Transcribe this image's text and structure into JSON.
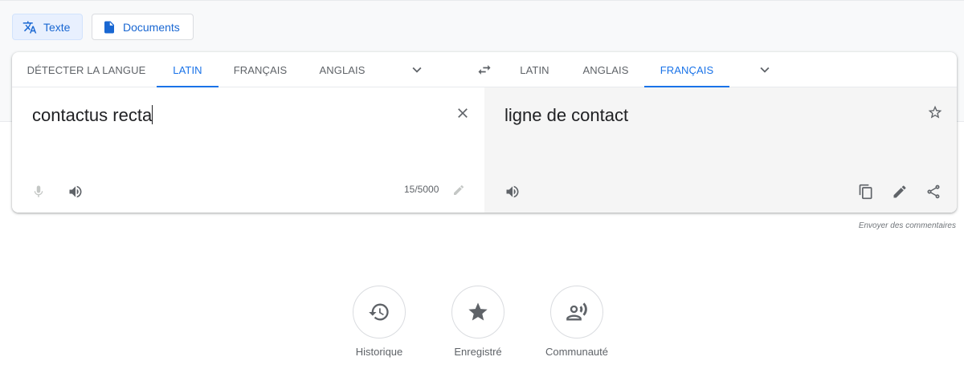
{
  "mode_buttons": {
    "text_label": "Texte",
    "docs_label": "Documents"
  },
  "source_langs": [
    "DÉTECTER LA LANGUE",
    "LATIN",
    "FRANÇAIS",
    "ANGLAIS"
  ],
  "target_langs": [
    "LATIN",
    "ANGLAIS",
    "FRANÇAIS"
  ],
  "selected_source": "LATIN",
  "selected_target": "FRANÇAIS",
  "source": {
    "text": "contactus recta",
    "char_count": "15/5000"
  },
  "target": {
    "text": "ligne de contact"
  },
  "feedback_link": "Envoyer des commentaires",
  "actions": {
    "history": "Historique",
    "saved": "Enregistré",
    "community": "Communauté"
  },
  "colors": {
    "accent": "#1a73e8",
    "text": "#5f6368",
    "target_bg": "#f5f5f5"
  },
  "icons": [
    "translate-icon",
    "document-icon",
    "chevron-down-icon",
    "swap-icon",
    "close-icon",
    "microphone-icon",
    "speaker-icon",
    "pencil-icon",
    "star-icon",
    "copy-icon",
    "share-icon",
    "history-icon",
    "community-icon"
  ]
}
